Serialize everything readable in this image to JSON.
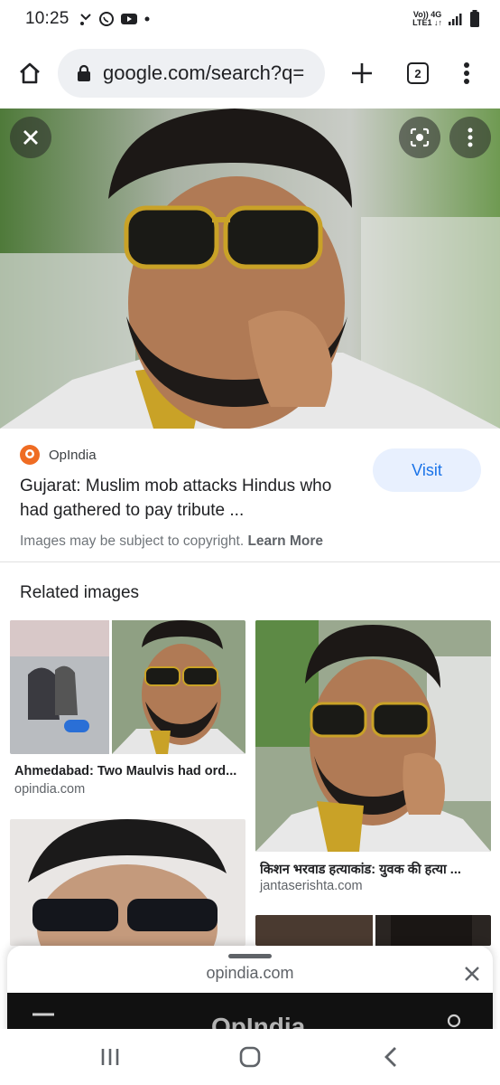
{
  "status_bar": {
    "time": "10:25",
    "network_top": "Vo)) 4G",
    "network_bottom": "LTE1 ↓↑"
  },
  "browser": {
    "url": "google.com/search?q=",
    "tab_count": "2"
  },
  "result": {
    "source_name": "OpIndia",
    "title": "Gujarat: Muslim mob attacks Hindus who had gathered to pay tribute ...",
    "visit_label": "Visit",
    "copyright_text": "Images may be subject to copyright.",
    "learn_more": "Learn More"
  },
  "related": {
    "heading": "Related images",
    "items": [
      {
        "title": "Ahmedabad: Two Maulvis had ord...",
        "domain": "opindia.com"
      },
      {
        "title": "किशन भरवाड हत्याकांड: युवक की हत्या ...",
        "domain": "jantaserishta.com"
      }
    ]
  },
  "sheet": {
    "url": "opindia.com",
    "page_logo": "OpIndia"
  },
  "colors": {
    "accent": "#1a73e8",
    "visit_bg": "#e8f0fe",
    "source_logo": "#ef6c23"
  }
}
